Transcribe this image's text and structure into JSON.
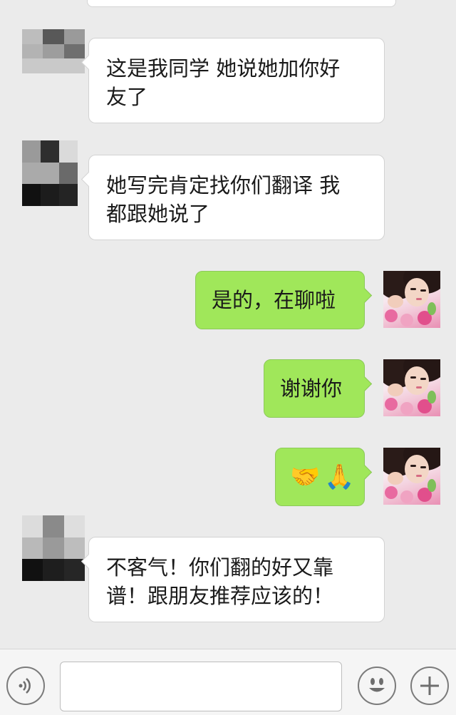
{
  "messages": [
    {
      "side": "left",
      "text": "这是我同学 她说她加你好友了",
      "lines": [
        "这是我同学 她说她加你好",
        "友了"
      ]
    },
    {
      "side": "left",
      "text": "她写完肯定找你们翻译 我都跟她说了",
      "lines": [
        "她写完肯定找你们翻译 我",
        "都跟她说了"
      ]
    },
    {
      "side": "right",
      "text": "是的，在聊啦"
    },
    {
      "side": "right",
      "text": "谢谢你"
    },
    {
      "side": "right",
      "emoji": [
        "🤝",
        "🙏"
      ]
    },
    {
      "side": "left",
      "text": "不客气！你们翻的好又靠谱！跟朋友推荐应该的！",
      "lines": [
        "不客气！你们翻的好又靠",
        "谱！跟朋友推荐应该的！"
      ]
    }
  ],
  "icons": {
    "voice": "voice-icon",
    "emoji": "smiley-icon",
    "more": "plus-icon"
  },
  "input": {
    "value": "",
    "placeholder": ""
  },
  "colors": {
    "background": "#ebebeb",
    "incoming_bubble": "#ffffff",
    "outgoing_bubble": "#a0e75a"
  }
}
